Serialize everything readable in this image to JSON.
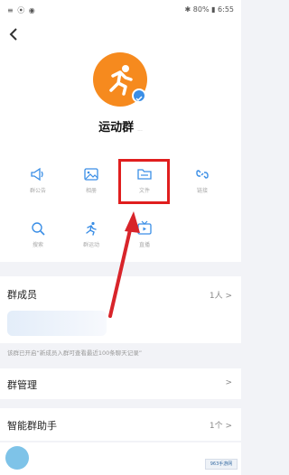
{
  "status_bar": {
    "left_icons": "≡ ⦿ ◉",
    "right_text": "✱ 80% ▮ 6:55"
  },
  "header": {
    "back_icon": "chevron-left-icon"
  },
  "group": {
    "name": "运动群",
    "name_tag": "...",
    "avatar_icon": "runner-icon",
    "avatar_color": "#f68a1e"
  },
  "features": [
    {
      "icon": "megaphone-icon",
      "label": "群公告"
    },
    {
      "icon": "image-icon",
      "label": "相册"
    },
    {
      "icon": "folder-icon",
      "label": "文件"
    },
    {
      "icon": "link-icon",
      "label": "链接"
    },
    {
      "icon": "search-icon",
      "label": "搜索"
    },
    {
      "icon": "runner-icon",
      "label": "群运动"
    },
    {
      "icon": "tv-icon",
      "label": "直播"
    }
  ],
  "members": {
    "title": "群成员",
    "count": "1人 >"
  },
  "notice": "该群已开启“新成员入群可查看最近100条聊天记录”",
  "management": {
    "title": "群管理",
    "chevron": ">"
  },
  "assistant": {
    "title": "智能群助手",
    "count": "1个 >"
  },
  "watermark": "963手游网",
  "colors": {
    "highlight": "#e01e1e",
    "accent": "#3a8ee6"
  }
}
